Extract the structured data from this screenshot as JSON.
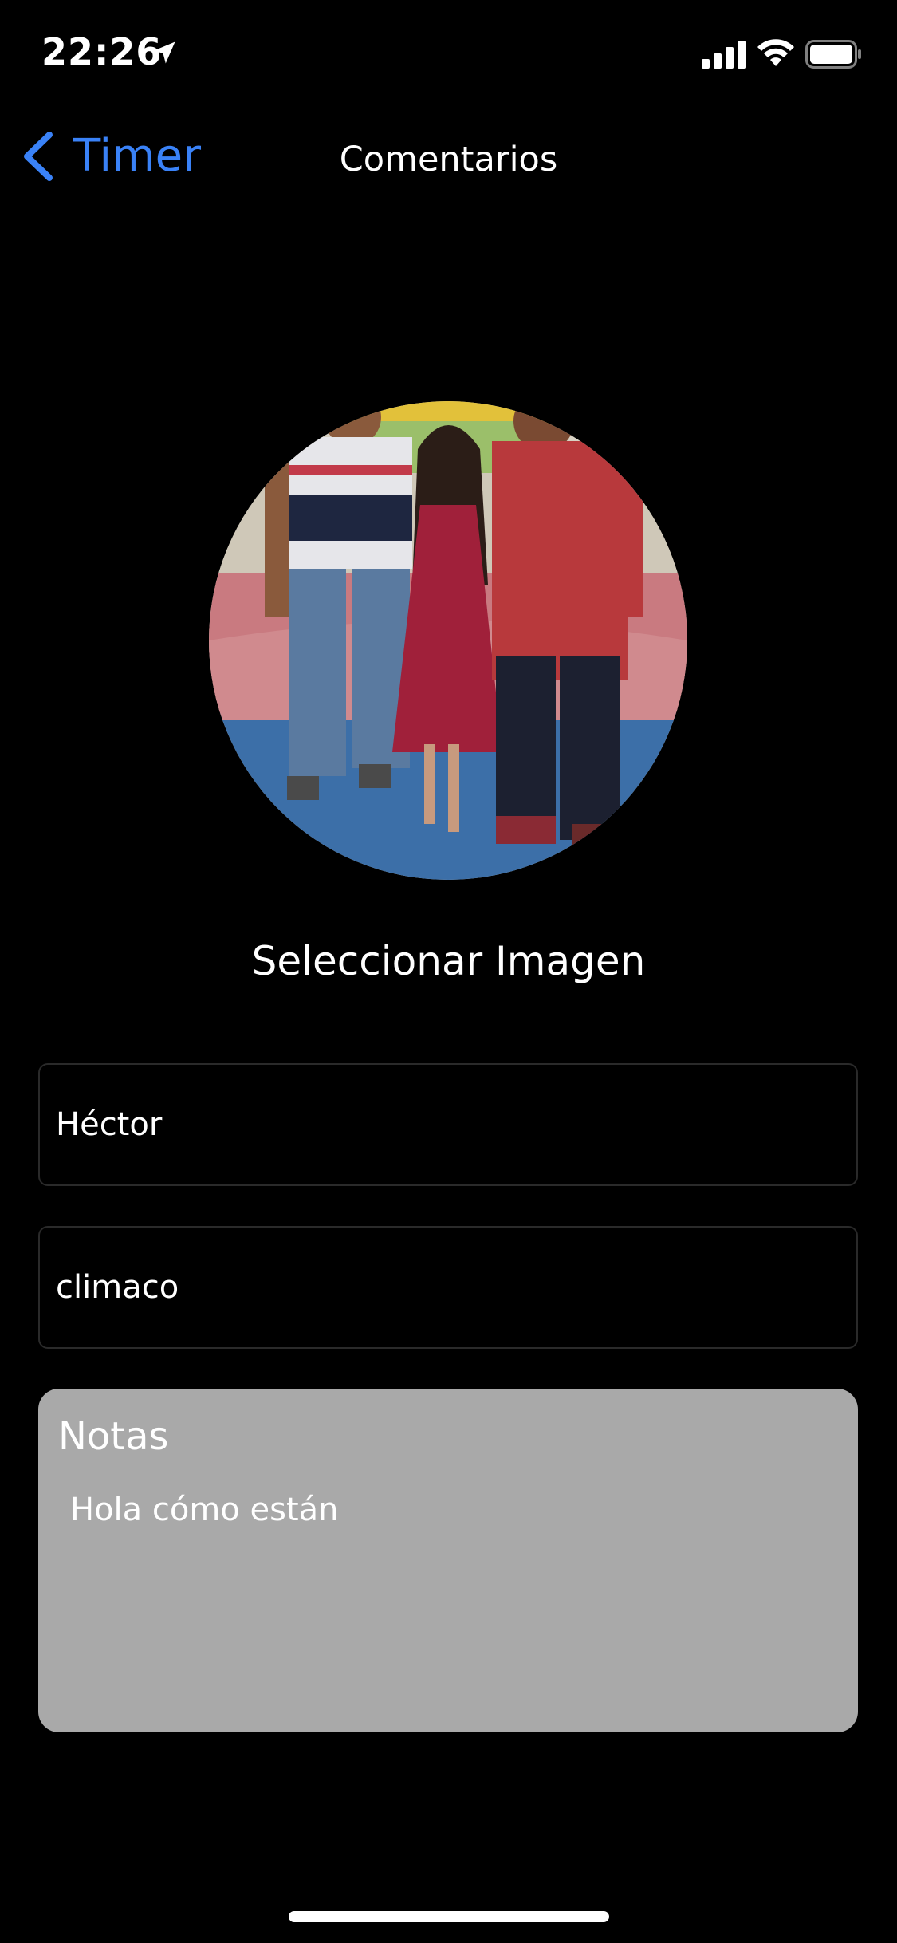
{
  "status_bar": {
    "time": "22:26",
    "location_icon": "location-arrow-icon",
    "signal_icon": "cellular-signal-icon",
    "wifi_icon": "wifi-icon",
    "battery_icon": "battery-full-icon"
  },
  "nav": {
    "back_label": "Timer",
    "back_icon": "chevron-left-icon",
    "title": "Comentarios",
    "accent_color": "#3a82f7"
  },
  "profile": {
    "avatar_alt": "photo",
    "select_image_label": "Seleccionar Imagen"
  },
  "form": {
    "first_name_value": "Héctor",
    "last_name_value": "climaco",
    "notes_title": "Notas",
    "notes_value": "Hola cómo están",
    "notes_background": "#a9a9a9"
  }
}
